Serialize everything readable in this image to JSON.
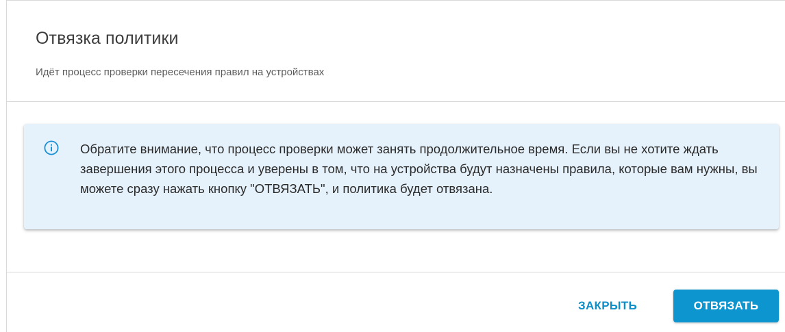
{
  "dialog": {
    "title": "Отвязка политики",
    "subtitle": "Идёт процесс проверки пересечения правил на устройствах"
  },
  "alert": {
    "icon": "info-icon",
    "text": "Обратите внимание, что процесс проверки может занять продолжительное время. Если вы не хотите ждать завершения этого процесса и уверены в том, что на устройства будут назначены правила, которые вам нужны, вы можете сразу нажать кнопку \"ОТВЯЗАТЬ\", и политика будет отвязана.",
    "background_color": "#e6f2fb",
    "icon_color": "#1a8fd6"
  },
  "footer": {
    "close_label": "ЗАКРЫТЬ",
    "detach_label": "ОТВЯЗАТЬ"
  },
  "colors": {
    "accent": "#0d95d0",
    "link_button": "#0d8ec9"
  }
}
